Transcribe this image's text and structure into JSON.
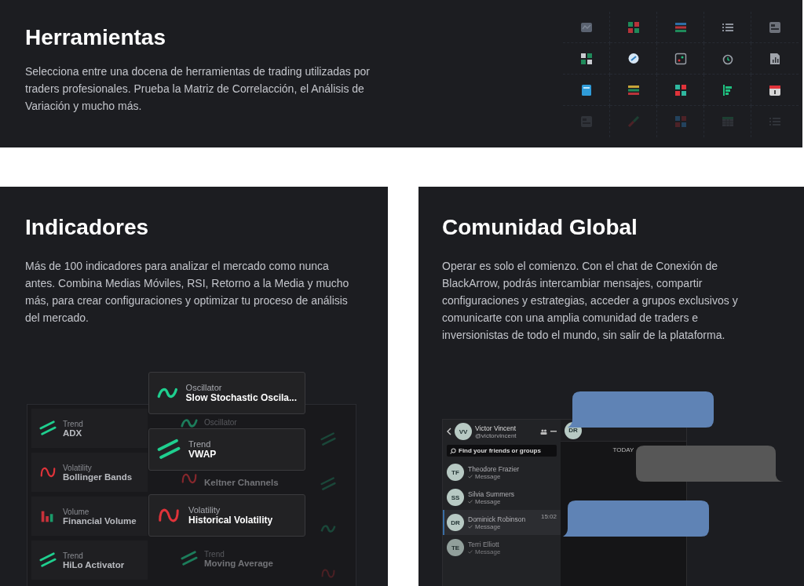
{
  "tools": {
    "title": "Herramientas",
    "description": "Selecciona entre una docena de herramientas de trading utilizadas por traders profesionales. Prueba la Matriz de Correlacción, el Análisis de Variación y mucho más."
  },
  "indicators": {
    "title": "Indicadores",
    "description": "Más de 100 indicadores para analizar el mercado como nunca antes. Combina Medias Móviles, RSI, Retorno a la Media y mucho más, para crear configuraciones y optimizar tu proceso de análisis del mercado.",
    "list": [
      {
        "kind": "trend",
        "category": "Trend",
        "name": "ADX"
      },
      {
        "kind": "oscillator",
        "category": "Oscillator"
      },
      {
        "kind": "volatility",
        "category": "Volatility",
        "name": "Bollinger Bands"
      },
      {
        "kind": "volatility",
        "name": "Keltner Channels"
      },
      {
        "kind": "volume",
        "category": "Volume",
        "name": "Financial Volume"
      },
      {
        "kind": "none"
      },
      {
        "kind": "trend",
        "category": "Trend",
        "name": "HiLo Activator"
      },
      {
        "kind": "trend",
        "category": "Trend",
        "name": "Moving Average"
      }
    ],
    "featured": [
      {
        "kind": "oscillator",
        "category": "Oscillator",
        "name": "Slow Stochastic Oscila..."
      },
      {
        "kind": "trend",
        "category": "Trend",
        "name": "VWAP"
      },
      {
        "kind": "volatility",
        "category": "Volatility",
        "name": "Historical Volatility"
      }
    ]
  },
  "community": {
    "title": "Comunidad Global",
    "description": "Operar es solo el comienzo. Con el chat de Conexión de BlackArrow, podrás intercambiar mensajes, compartir configuraciones y estrategias, acceder a grupos exclusivos y comunicarte con una amplia comunidad de traders e inversionistas de todo el mundo, sin salir de la plataforma.",
    "chat": {
      "user": {
        "initials": "VV",
        "name": "Victor Vincent",
        "handle": "@victorvincent"
      },
      "search": {
        "placeholder": "Find your friends or groups"
      },
      "contacts": [
        {
          "initials": "TF",
          "name": "Theodore Frazier",
          "preview": "Message",
          "selected": false
        },
        {
          "initials": "SS",
          "name": "Silvia Summers",
          "preview": "Message",
          "selected": false
        },
        {
          "initials": "DR",
          "name": "Dominick Robinson",
          "preview": "Message",
          "time": "15:02",
          "selected": true
        },
        {
          "initials": "TE",
          "name": "Terri Elliott",
          "preview": "Message",
          "selected": false
        }
      ],
      "conversation": {
        "initials": "DR",
        "day": "TODAY"
      },
      "bubbles": [
        {
          "kind": "incoming",
          "color": "#5f83b5"
        },
        {
          "kind": "outgoing",
          "color": "#575757"
        },
        {
          "kind": "incoming",
          "color": "#5f83b5"
        }
      ]
    }
  }
}
